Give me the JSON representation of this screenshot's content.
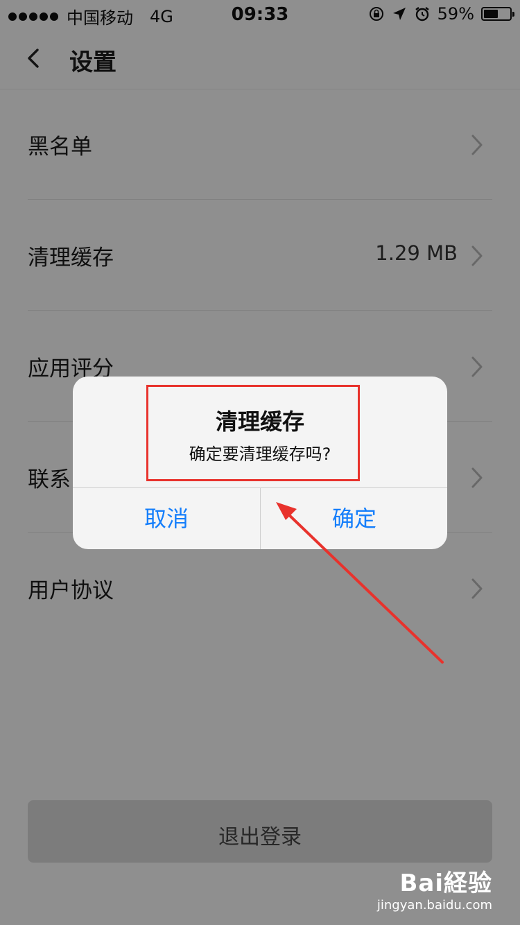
{
  "status_bar": {
    "carrier": "中国移动",
    "network": "4G",
    "time": "09:33",
    "battery_percent": "59%",
    "battery_level": 0.59
  },
  "nav": {
    "title": "设置"
  },
  "settings": [
    {
      "label": "黑名单",
      "value": ""
    },
    {
      "label": "清理缓存",
      "value": "1.29 MB"
    },
    {
      "label": "应用评分",
      "value": ""
    },
    {
      "label": "联系",
      "value": ""
    },
    {
      "label": "用户协议",
      "value": ""
    }
  ],
  "logout_label": "退出登录",
  "alert": {
    "title": "清理缓存",
    "message": "确定要清理缓存吗?",
    "cancel_label": "取消",
    "confirm_label": "确定"
  },
  "colors": {
    "alert_button": "#147efb",
    "annotation": "#e8322c"
  },
  "watermark": {
    "brand": "Bai経验",
    "url": "jingyan.baidu.com"
  }
}
